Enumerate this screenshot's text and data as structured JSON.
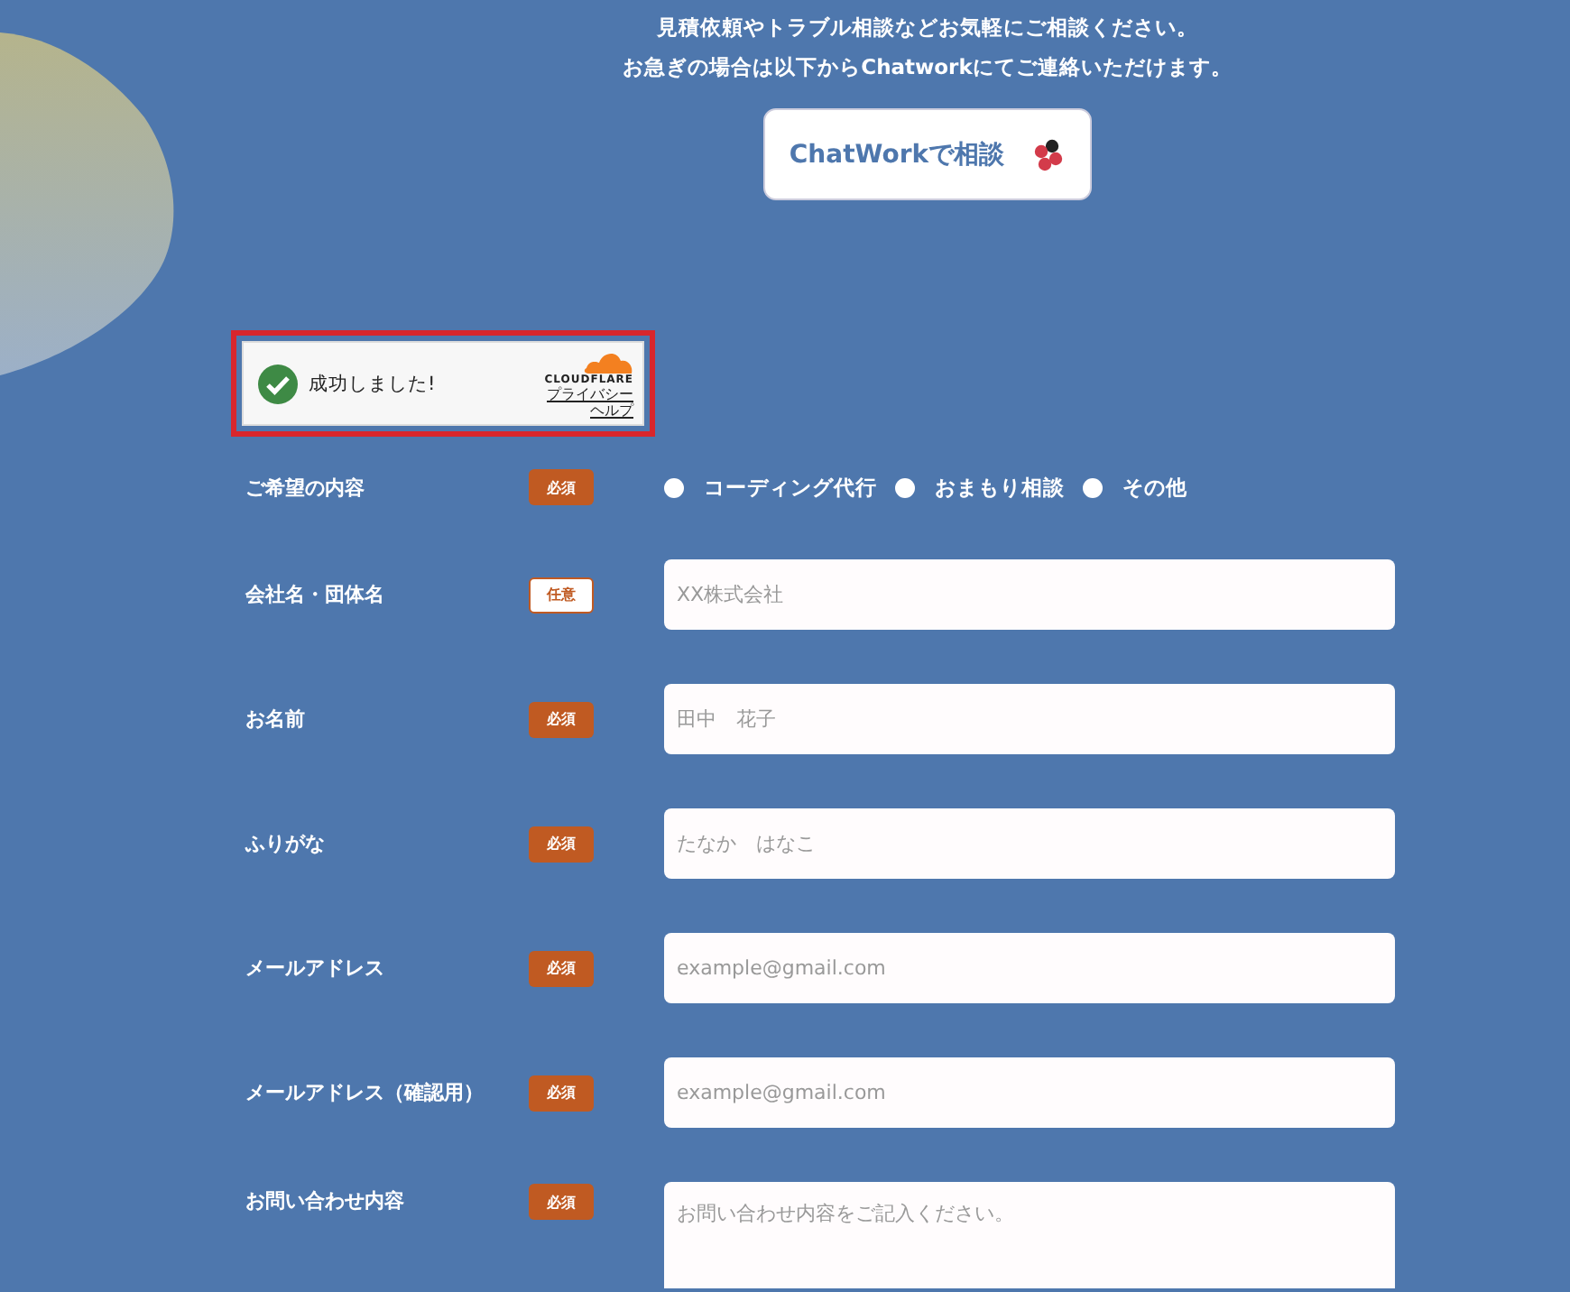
{
  "intro": {
    "lines": [
      "見積依頼やトラブル相談などお気軽にご相談ください。",
      "お急ぎの場合は以下からChatworkにてご連絡いただけます。"
    ],
    "button": "ChatWorkで相談"
  },
  "captcha": {
    "status": "成功しました!",
    "brand": "CLOUDFLARE",
    "links": [
      "プライバシー",
      "ヘルプ"
    ]
  },
  "form": [
    {
      "label": "ご希望の内容",
      "badge": {
        "kind": "required",
        "text": "必須"
      },
      "kind": "radio",
      "options": [
        {
          "label": "コーディング代行",
          "selected": false
        },
        {
          "label": "おまもり相談",
          "selected": false
        },
        {
          "label": "その他",
          "selected": false
        }
      ]
    },
    {
      "label": "会社名・団体名",
      "badge": {
        "kind": "optional",
        "text": "任意"
      },
      "kind": "text",
      "placeholder": "XX株式会社"
    },
    {
      "label": "お名前",
      "badge": {
        "kind": "required",
        "text": "必須"
      },
      "kind": "text",
      "placeholder": "田中　花子"
    },
    {
      "label": "ふりがな",
      "badge": {
        "kind": "required",
        "text": "必須"
      },
      "kind": "text",
      "placeholder": "たなか　はなこ"
    },
    {
      "label": "メールアドレス",
      "badge": {
        "kind": "required",
        "text": "必須"
      },
      "kind": "text",
      "placeholder": "example@gmail.com"
    },
    {
      "label": "メールアドレス（確認用）",
      "badge": {
        "kind": "required",
        "text": "必須"
      },
      "kind": "text",
      "placeholder": "example@gmail.com"
    },
    {
      "label": "お問い合わせ内容",
      "badge": {
        "kind": "required",
        "text": "必須"
      },
      "kind": "textarea",
      "placeholder": "お問い合わせ内容をご記入ください。"
    }
  ]
}
